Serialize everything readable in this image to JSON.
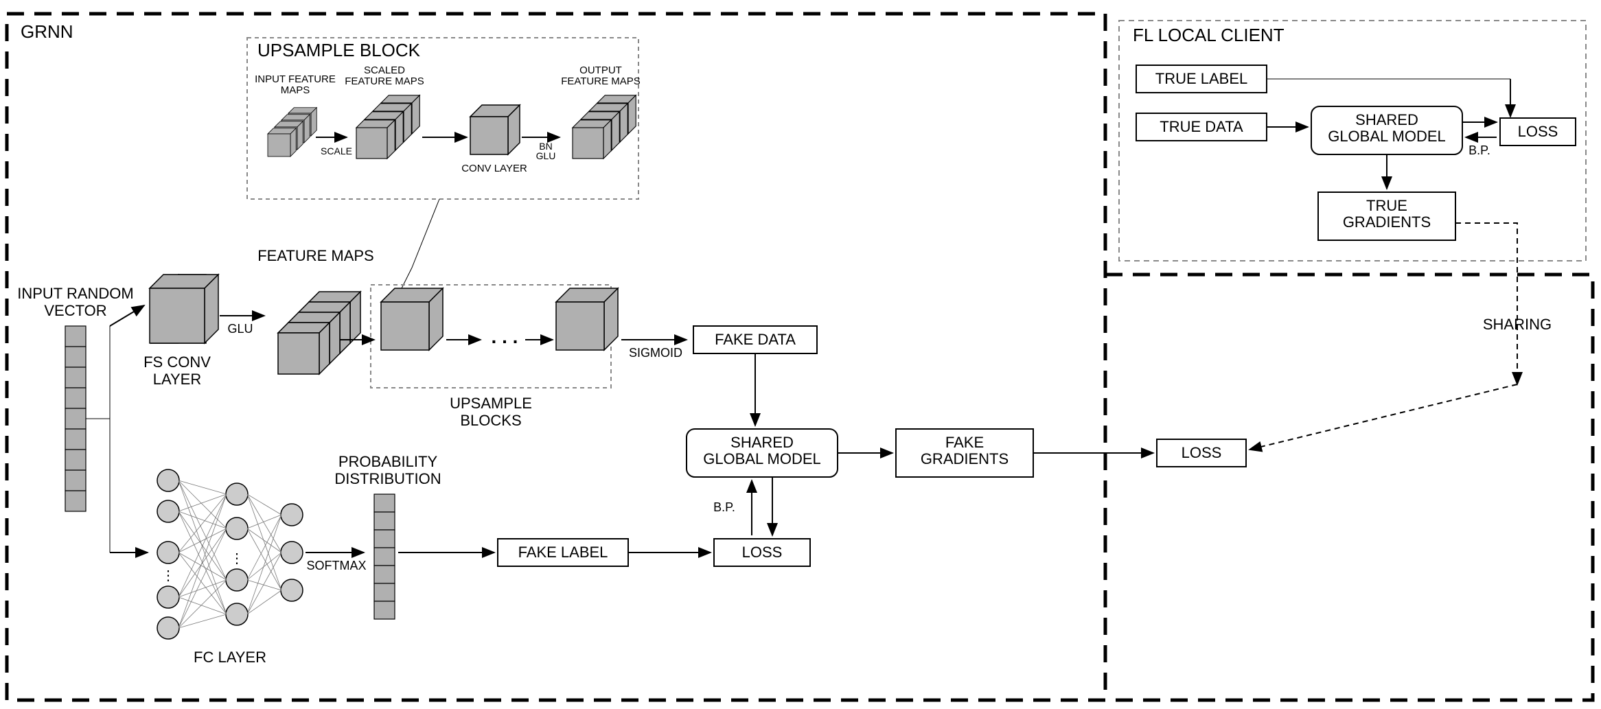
{
  "sections": {
    "grnn": "GRNN",
    "upsample_block": "UPSAMPLE BLOCK",
    "fl_local_client": "FL LOCAL CLIENT"
  },
  "labels": {
    "input_random_vector_l1": "INPUT RANDOM",
    "input_random_vector_l2": "VECTOR",
    "fs_conv_l1": "FS CONV",
    "fs_conv_l2": "LAYER",
    "glu": "GLU",
    "feature_maps": "FEATURE MAPS",
    "input_feature_l1": "INPUT FEATURE",
    "input_feature_l2": "MAPS",
    "scale": "SCALE",
    "scaled_l1": "SCALED",
    "scaled_l2": "FEATURE MAPS",
    "conv_layer": "CONV LAYER",
    "bn": "BN",
    "glu2": "GLU",
    "output_l1": "OUTPUT",
    "output_l2": "FEATURE MAPS",
    "upsample_blocks_l1": "UPSAMPLE",
    "upsample_blocks_l2": "BLOCKS",
    "dots": ". . .",
    "sigmoid": "SIGMOID",
    "fake_data": "FAKE DATA",
    "shared_global_l1": "SHARED",
    "shared_global_l2": "GLOBAL MODEL",
    "fake_gradients_l1": "FAKE",
    "fake_gradients_l2": "GRADIENTS",
    "loss": "LOSS",
    "bp": "B.P.",
    "fc_layer": "FC LAYER",
    "softmax": "SOFTMAX",
    "prob_dist_l1": "PROBABILITY",
    "prob_dist_l2": "DISTRIBUTION",
    "fake_label": "FAKE LABEL",
    "true_label": "TRUE LABEL",
    "true_data": "TRUE DATA",
    "true_gradients_l1": "TRUE",
    "true_gradients_l2": "GRADIENTS",
    "sharing": "SHARING"
  }
}
